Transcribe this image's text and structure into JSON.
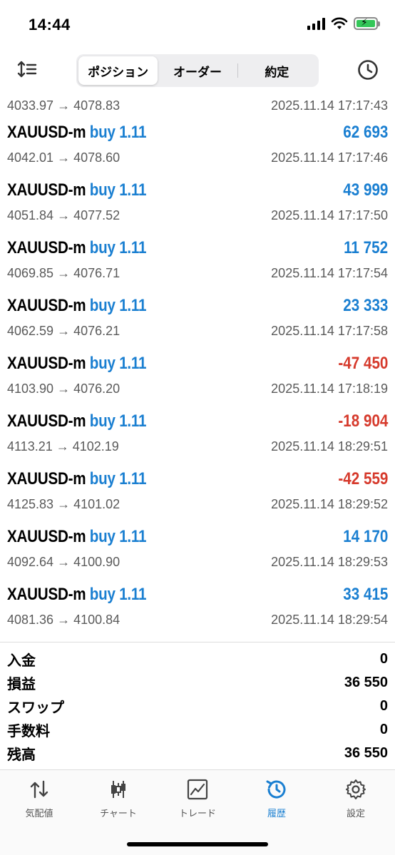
{
  "status_bar": {
    "time": "14:44",
    "battery_color": "#34c759"
  },
  "toolbar": {
    "segments": [
      {
        "label": "ポジション",
        "active": false
      },
      {
        "label": "オーダー",
        "active": false
      },
      {
        "label": "約定",
        "active": false
      }
    ],
    "sort_icon": "sort-icon",
    "history_icon": "clock-icon"
  },
  "trades_partial": {
    "prices": "4033.97 → 4078.83",
    "time": "2025.11.14 17:17:43"
  },
  "trades": [
    {
      "symbol": "XAUUSD-m",
      "side": "buy 1.11",
      "profit": "62 693",
      "sign": "pos",
      "prices": "4042.01 → 4078.60",
      "time": "2025.11.14 17:17:46"
    },
    {
      "symbol": "XAUUSD-m",
      "side": "buy 1.11",
      "profit": "43 999",
      "sign": "pos",
      "prices": "4051.84 → 4077.52",
      "time": "2025.11.14 17:17:50"
    },
    {
      "symbol": "XAUUSD-m",
      "side": "buy 1.11",
      "profit": "11 752",
      "sign": "pos",
      "prices": "4069.85 → 4076.71",
      "time": "2025.11.14 17:17:54"
    },
    {
      "symbol": "XAUUSD-m",
      "side": "buy 1.11",
      "profit": "23 333",
      "sign": "pos",
      "prices": "4062.59 → 4076.21",
      "time": "2025.11.14 17:17:58"
    },
    {
      "symbol": "XAUUSD-m",
      "side": "buy 1.11",
      "profit": "-47 450",
      "sign": "neg",
      "prices": "4103.90 → 4076.20",
      "time": "2025.11.14 17:18:19"
    },
    {
      "symbol": "XAUUSD-m",
      "side": "buy 1.11",
      "profit": "-18 904",
      "sign": "neg",
      "prices": "4113.21 → 4102.19",
      "time": "2025.11.14 18:29:51"
    },
    {
      "symbol": "XAUUSD-m",
      "side": "buy 1.11",
      "profit": "-42 559",
      "sign": "neg",
      "prices": "4125.83 → 4101.02",
      "time": "2025.11.14 18:29:52"
    },
    {
      "symbol": "XAUUSD-m",
      "side": "buy 1.11",
      "profit": "14 170",
      "sign": "pos",
      "prices": "4092.64 → 4100.90",
      "time": "2025.11.14 18:29:53"
    },
    {
      "symbol": "XAUUSD-m",
      "side": "buy 1.11",
      "profit": "33 415",
      "sign": "pos",
      "prices": "4081.36 → 4100.84",
      "time": "2025.11.14 18:29:54"
    }
  ],
  "summary": [
    {
      "label": "入金",
      "value": "0"
    },
    {
      "label": "損益",
      "value": "36 550"
    },
    {
      "label": "スワップ",
      "value": "0"
    },
    {
      "label": "手数料",
      "value": "0"
    },
    {
      "label": "残高",
      "value": "36 550"
    }
  ],
  "tabbar": {
    "tabs": [
      {
        "label": "気配値",
        "icon": "quotes-icon",
        "active": false
      },
      {
        "label": "チャート",
        "icon": "candlestick-chart-icon",
        "active": false
      },
      {
        "label": "トレード",
        "icon": "trade-chart-icon",
        "active": false
      },
      {
        "label": "履歴",
        "icon": "history-icon",
        "active": true
      },
      {
        "label": "設定",
        "icon": "gear-icon",
        "active": false
      }
    ]
  },
  "colors": {
    "accent": "#1a7fd1",
    "positive": "#1a7fd1",
    "negative": "#d63a2c"
  }
}
